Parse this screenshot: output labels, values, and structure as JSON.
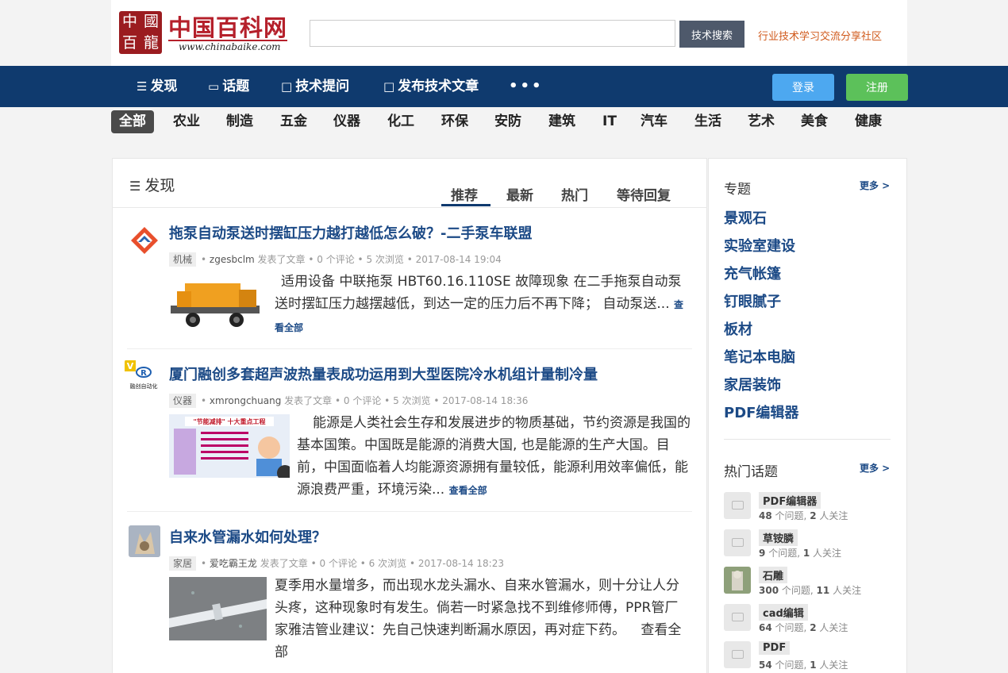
{
  "header": {
    "logo_seal_chars": [
      "中",
      "國",
      "百",
      "龍"
    ],
    "logo_title": "中国百科网",
    "logo_url": "www.chinabaike.com",
    "search_placeholder": "",
    "search_button": "技术搜索",
    "slogan": "行业技术学习交流分享社区"
  },
  "nav": {
    "items": [
      {
        "icon": "list-icon",
        "label": "发现"
      },
      {
        "icon": "chat-icon",
        "label": "话题"
      },
      {
        "icon": "edit-icon",
        "label": "技术提问"
      },
      {
        "icon": "publish-icon",
        "label": "发布技术文章"
      }
    ],
    "more": "•••",
    "login": "登录",
    "register": "注册"
  },
  "categories": [
    "全部",
    "农业",
    "制造",
    "五金",
    "仪器",
    "化工",
    "环保",
    "安防",
    "建筑",
    "IT",
    "汽车",
    "生活",
    "艺术",
    "美食",
    "健康"
  ],
  "main": {
    "title": "发现",
    "tabs": [
      "推荐",
      "最新",
      "热门",
      "等待回复"
    ],
    "active_tab": "推荐",
    "questions": [
      {
        "title": "拖泵自动泵送时摆缸压力越打越低怎么破？-二手泵车联盟",
        "tag": "机械",
        "user": "zgesbclm",
        "action": "发表了文章",
        "comments": "0 个评论",
        "views": "5 次浏览",
        "time": "2017-08-14 19:04",
        "text": "适用设备 中联拖泵  HBT60.16.110SE 故障现象 在二手拖泵自动泵送时摆缸压力越摆越低，到达一定的压力后不再下降； 自动泵送...",
        "read_all": "查看全部"
      },
      {
        "title": "厦门融创多套超声波热量表成功运用到大型医院冷水机组计量制冷量",
        "tag": "仪器",
        "user": "xmrongchuang",
        "action": "发表了文章",
        "comments": "0 个评论",
        "views": "5 次浏览",
        "time": "2017-08-14 18:36",
        "avatar_text": "融创自动化",
        "thumb_caption": "\"节能减排\" 十大重点工程",
        "text": "能源是人类社会生存和发展进步的物质基础，节约资源是我国的基本国策。中国既是能源的消费大国, 也是能源的生产大国。目前，中国面临着人均能源资源拥有量较低，能源利用效率偏低，能源浪费严重，环境污染...",
        "read_all": "查看全部"
      },
      {
        "title": "自来水管漏水如何处理？",
        "tag": "家居",
        "user": "爱吃霸王龙",
        "action": "发表了文章",
        "comments": "0 个评论",
        "views": "6 次浏览",
        "time": "2017-08-14 18:23",
        "text": "夏季用水量增多，而出现水龙头漏水、自来水管漏水，则十分让人分头疼，这种现象时有发生。倘若一时紧急找不到维修师傅，PPR管厂家雅洁管业建议：先自己快速判断漏水原因，再对症下药。",
        "read_all": "查看全部"
      }
    ]
  },
  "sidebar": {
    "topics_title": "专题",
    "more": "更多 >",
    "topics": [
      "景观石",
      "实验室建设",
      "充气帐篷",
      "钉眼腻子",
      "板材",
      "笔记本电脑",
      "家居装饰",
      "PDF编辑器"
    ],
    "hot_title": "热门话题",
    "hot_topics": [
      {
        "name": "PDF编辑器",
        "questions": "48",
        "q_label": "个问题,",
        "followers": "2",
        "f_label": "人关注"
      },
      {
        "name": "草铵膦",
        "questions": "9",
        "q_label": "个问题,",
        "followers": "1",
        "f_label": "人关注"
      },
      {
        "name": "石雕",
        "questions": "300",
        "q_label": "个问题,",
        "followers": "11",
        "f_label": "人关注"
      },
      {
        "name": "cad编辑",
        "questions": "64",
        "q_label": "个问题,",
        "followers": "2",
        "f_label": "人关注"
      },
      {
        "name": "PDF",
        "questions": "54",
        "q_label": "个问题,",
        "followers": "1",
        "f_label": "人关注"
      }
    ]
  }
}
